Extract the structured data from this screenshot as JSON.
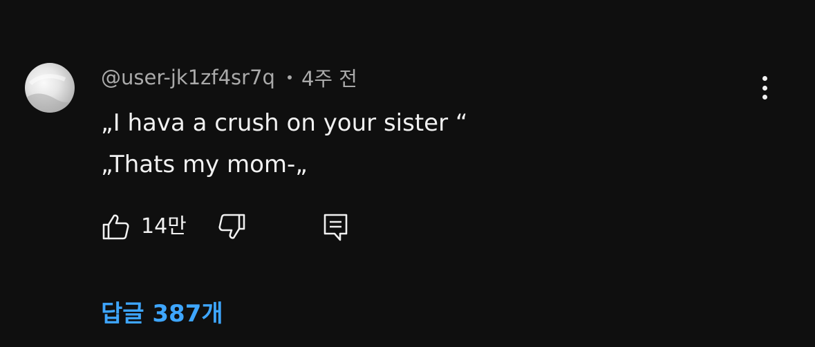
{
  "comment": {
    "author": "@user-jk1zf4sr7q",
    "time": "4주 전",
    "lines": [
      "„I hava a crush on your sister “",
      "„Thats my mom-„"
    ],
    "like_count": "14만",
    "replies_label": "답글 387개"
  },
  "icons": {
    "avatar": "avatar-image",
    "more": "more-vert-icon",
    "like": "thumbs-up-icon",
    "dislike": "thumbs-down-icon",
    "reply": "reply-comment-icon"
  },
  "colors": {
    "background": "#0f0f0f",
    "text_primary": "#f1f1f1",
    "text_secondary": "#aaaaaa",
    "accent": "#3ea6ff"
  }
}
